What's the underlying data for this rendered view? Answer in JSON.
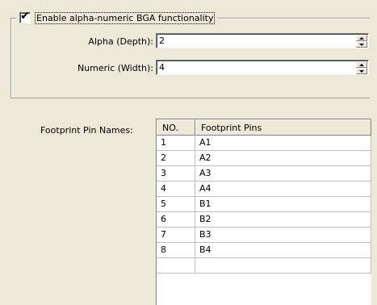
{
  "group": {
    "checkbox_checked": true,
    "checkbox_label": "Enable alpha-numeric BGA functionality"
  },
  "alpha": {
    "label": "Alpha (Depth):",
    "value": "2"
  },
  "numeric": {
    "label": "Numeric (Width):",
    "value": "4"
  },
  "table": {
    "label": "Footprint Pin Names:",
    "columns": [
      "NO.",
      "Footprint Pins"
    ],
    "rows": [
      {
        "no": "1",
        "pin": "A1"
      },
      {
        "no": "2",
        "pin": "A2"
      },
      {
        "no": "3",
        "pin": "A3"
      },
      {
        "no": "4",
        "pin": "A4"
      },
      {
        "no": "5",
        "pin": "B1"
      },
      {
        "no": "6",
        "pin": "B2"
      },
      {
        "no": "7",
        "pin": "B3"
      },
      {
        "no": "8",
        "pin": "B4"
      }
    ]
  },
  "icons": {
    "checkmark": "checkmark-icon",
    "spin_up": "spin-up-icon",
    "spin_down": "spin-down-icon"
  }
}
